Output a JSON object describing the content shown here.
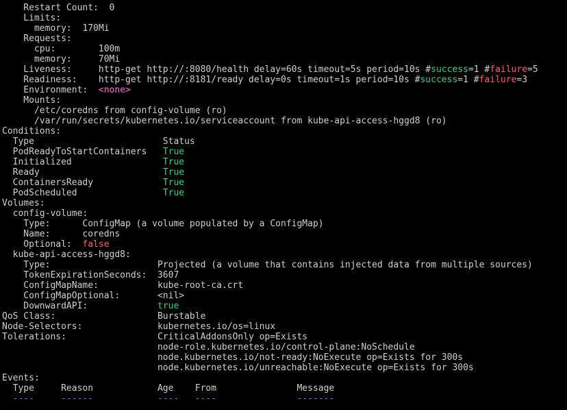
{
  "terminal": {
    "background": "#000000",
    "colors": {
      "default": "#d0d0d0",
      "green": "#2fd37f",
      "red": "#ff5a6e",
      "magenta": "#ff6ad0",
      "blue": "#3b8df0"
    },
    "lines": [
      [
        {
          "t": "    Restart Count:  0"
        }
      ],
      [
        {
          "t": "    Limits:"
        }
      ],
      [
        {
          "t": "      memory:  170Mi"
        }
      ],
      [
        {
          "t": "    Requests:"
        }
      ],
      [
        {
          "t": "      cpu:        100m"
        }
      ],
      [
        {
          "t": "      memory:     70Mi"
        }
      ],
      [
        {
          "t": "    Liveness:     http-get http://:8080/health delay=60s timeout=5s period=10s #"
        },
        {
          "t": "success",
          "c": "green"
        },
        {
          "t": "=1 #"
        },
        {
          "t": "failure",
          "c": "red"
        },
        {
          "t": "=5"
        }
      ],
      [
        {
          "t": "    Readiness:    http-get http://:8181/ready delay=0s timeout=1s period=10s #"
        },
        {
          "t": "success",
          "c": "green"
        },
        {
          "t": "=1 #"
        },
        {
          "t": "failure",
          "c": "red"
        },
        {
          "t": "=3"
        }
      ],
      [
        {
          "t": "    Environment:  "
        },
        {
          "t": "<none>",
          "c": "magenta"
        }
      ],
      [
        {
          "t": "    Mounts:"
        }
      ],
      [
        {
          "t": "      /etc/coredns from config-volume (ro)"
        }
      ],
      [
        {
          "t": "      /var/run/secrets/kubernetes.io/serviceaccount from kube-api-access-hggd8 (ro)"
        }
      ],
      [
        {
          "t": "Conditions:"
        }
      ],
      [
        {
          "t": "  Type                        Status"
        }
      ],
      [
        {
          "t": "  PodReadyToStartContainers   "
        },
        {
          "t": "True",
          "c": "green"
        }
      ],
      [
        {
          "t": "  Initialized                 "
        },
        {
          "t": "True",
          "c": "green"
        }
      ],
      [
        {
          "t": "  Ready                       "
        },
        {
          "t": "True",
          "c": "green"
        }
      ],
      [
        {
          "t": "  ContainersReady             "
        },
        {
          "t": "True",
          "c": "green"
        }
      ],
      [
        {
          "t": "  PodScheduled                "
        },
        {
          "t": "True",
          "c": "green"
        }
      ],
      [
        {
          "t": "Volumes:"
        }
      ],
      [
        {
          "t": "  config-volume:"
        }
      ],
      [
        {
          "t": "    Type:      ConfigMap (a volume populated by a ConfigMap)"
        }
      ],
      [
        {
          "t": "    Name:      coredns"
        }
      ],
      [
        {
          "t": "    Optional:  "
        },
        {
          "t": "false",
          "c": "red"
        }
      ],
      [
        {
          "t": "  kube-api-access-hggd8:"
        }
      ],
      [
        {
          "t": "    Type:                    Projected (a volume that contains injected data from multiple sources)"
        }
      ],
      [
        {
          "t": "    TokenExpirationSeconds:  3607"
        }
      ],
      [
        {
          "t": "    ConfigMapName:           kube-root-ca.crt"
        }
      ],
      [
        {
          "t": "    ConfigMapOptional:       <nil>"
        }
      ],
      [
        {
          "t": "    DownwardAPI:             "
        },
        {
          "t": "true",
          "c": "green"
        }
      ],
      [
        {
          "t": "QoS Class:                   Burstable"
        }
      ],
      [
        {
          "t": "Node-Selectors:              kubernetes.io/os=linux"
        }
      ],
      [
        {
          "t": "Tolerations:                 CriticalAddonsOnly op=Exists"
        }
      ],
      [
        {
          "t": "                             node-role.kubernetes.io/control-plane:NoSchedule"
        }
      ],
      [
        {
          "t": "                             node.kubernetes.io/not-ready:NoExecute op=Exists for 300s"
        }
      ],
      [
        {
          "t": "                             node.kubernetes.io/unreachable:NoExecute op=Exists for 300s"
        }
      ],
      [
        {
          "t": "Events:"
        }
      ],
      [
        {
          "t": "  Type     Reason            Age    From               Message"
        }
      ],
      [
        {
          "t": "  ",
          "c": "blue"
        },
        {
          "t": "----",
          "c": "blue"
        },
        {
          "t": "     "
        },
        {
          "t": "------",
          "c": "blue"
        },
        {
          "t": "            "
        },
        {
          "t": "----",
          "c": "blue"
        },
        {
          "t": "   "
        },
        {
          "t": "----",
          "c": "blue"
        },
        {
          "t": "               "
        },
        {
          "t": "-------",
          "c": "blue"
        }
      ]
    ]
  }
}
